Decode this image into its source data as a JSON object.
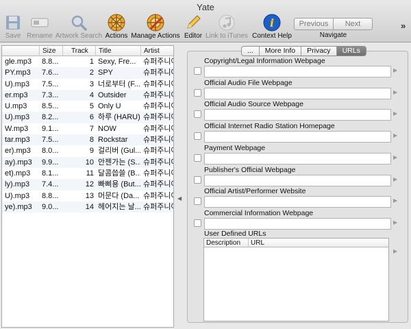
{
  "window": {
    "title": "Yate"
  },
  "toolbar": {
    "items": [
      {
        "label": "Save",
        "icon": "floppy-disk-icon",
        "enabled": false
      },
      {
        "label": "Rename",
        "icon": "rename-field-icon",
        "enabled": false
      },
      {
        "label": "Artwork Search",
        "icon": "magnifier-icon",
        "enabled": false
      },
      {
        "label": "Actions",
        "icon": "actions-wheel-icon",
        "enabled": true
      },
      {
        "label": "Manage Actions",
        "icon": "manage-actions-icon",
        "enabled": true
      },
      {
        "label": "Editor",
        "icon": "pencil-icon",
        "enabled": true
      },
      {
        "label": "Link to iTunes",
        "icon": "itunes-note-icon",
        "enabled": false
      },
      {
        "label": "Context Help",
        "icon": "info-icon",
        "enabled": true
      }
    ],
    "navigate": {
      "previous": "Previous",
      "next": "Next",
      "label": "Navigate"
    },
    "overflow": "»"
  },
  "file_table": {
    "columns": [
      "",
      "Size",
      "Track",
      "Title",
      "Artist"
    ],
    "rows": [
      [
        "gle.mp3",
        "8.8...",
        "1",
        "Sexy, Fre...",
        "슈퍼주니어"
      ],
      [
        "PY.mp3",
        "7.6...",
        "2",
        "SPY",
        "슈퍼주니어"
      ],
      [
        "U).mp3",
        "7.5...",
        "3",
        "너로부터 (F...",
        "슈퍼주니어"
      ],
      [
        "er.mp3",
        "7.3...",
        "4",
        "Outsider",
        "슈퍼주니어"
      ],
      [
        "U.mp3",
        "8.5...",
        "5",
        "Only U",
        "슈퍼주니어"
      ],
      [
        "U).mp3",
        "8.2...",
        "6",
        "하루 (HARU)",
        "슈퍼주니어"
      ],
      [
        "W.mp3",
        "9.1...",
        "7",
        "NOW",
        "슈퍼주니어"
      ],
      [
        "tar.mp3",
        "7.5...",
        "8",
        "Rockstar",
        "슈퍼주니어"
      ],
      [
        "er).mp3",
        "8.0...",
        "9",
        "걸리버 (Gul...",
        "슈퍼주니어"
      ],
      [
        "ay).mp3",
        "9.9...",
        "10",
        "안젠가는 (S...",
        "슈퍼주니어"
      ],
      [
        "et).mp3",
        "8.1...",
        "11",
        "달콤씁쓸 (B...",
        "슈퍼주니어"
      ],
      [
        "ly).mp3",
        "7.4...",
        "12",
        "빠삐용 (But...",
        "슈퍼주니어"
      ],
      [
        "U).mp3",
        "8.8...",
        "13",
        "머문다 (Da...",
        "슈퍼주니어"
      ],
      [
        "ye).mp3",
        "9.0...",
        "14",
        "헤어지는 날...",
        "슈퍼주니어"
      ]
    ]
  },
  "tabs": [
    {
      "label": "...",
      "active": false
    },
    {
      "label": "More Info",
      "active": false
    },
    {
      "label": "Privacy",
      "active": false
    },
    {
      "label": "URLs",
      "active": true
    }
  ],
  "url_fields": [
    {
      "label": "Copyright/Legal Information Webpage",
      "value": ""
    },
    {
      "label": "Official Audio File Webpage",
      "value": ""
    },
    {
      "label": "Official Audio Source Webpage",
      "value": ""
    },
    {
      "label": "Official Internet Radio Station Homepage",
      "value": ""
    },
    {
      "label": "Payment Webpage",
      "value": ""
    },
    {
      "label": "Publisher's Official Webpage",
      "value": ""
    },
    {
      "label": "Official Artist/Performer Website",
      "value": ""
    },
    {
      "label": "Commercial Information Webpage",
      "value": ""
    }
  ],
  "user_defined": {
    "label": "User Defined URLs",
    "columns": [
      "Description",
      "URL"
    ],
    "rows": []
  }
}
